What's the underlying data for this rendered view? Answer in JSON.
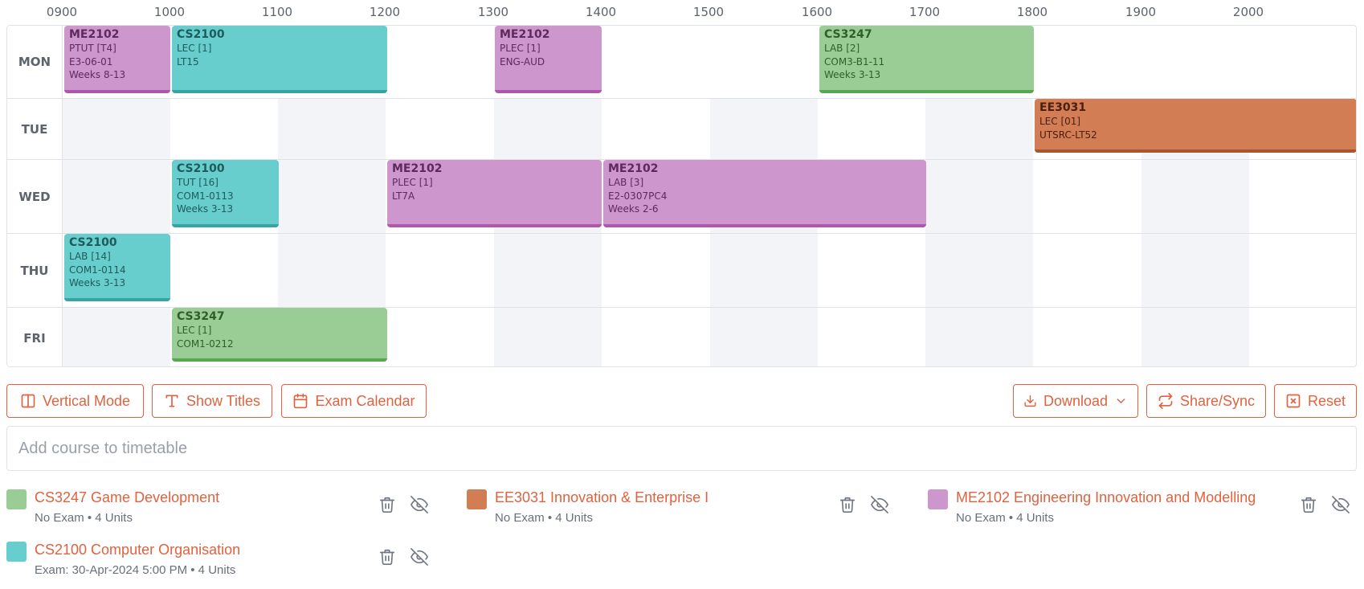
{
  "hours": [
    "0900",
    "1000",
    "1100",
    "1200",
    "1300",
    "1400",
    "1500",
    "1600",
    "1700",
    "1800",
    "1900",
    "2000"
  ],
  "days": [
    "MON",
    "TUE",
    "WED",
    "THU",
    "FRI"
  ],
  "colors": {
    "accent": "#e0623f",
    "green": "#9acd96",
    "teal": "#67cecd",
    "purple": "#cd97cd",
    "orange": "#d37d54",
    "stripe": "#f3f4f7"
  },
  "lessons": {
    "mon_me2102_ptut": {
      "code": "ME2102",
      "type": "PTUT [T4]",
      "venue": "E3-06-01",
      "weeks": "Weeks 8-13"
    },
    "mon_cs2100_lec": {
      "code": "CS2100",
      "type": "LEC [1]",
      "venue": "LT15"
    },
    "mon_me2102_plec": {
      "code": "ME2102",
      "type": "PLEC [1]",
      "venue": "ENG-AUD"
    },
    "mon_cs3247_lab": {
      "code": "CS3247",
      "type": "LAB [2]",
      "venue": "COM3-B1-11",
      "weeks": "Weeks 3-13"
    },
    "tue_ee3031_lec": {
      "code": "EE3031",
      "type": "LEC [01]",
      "venue": "UTSRC-LT52"
    },
    "wed_cs2100_tut": {
      "code": "CS2100",
      "type": "TUT [16]",
      "venue": "COM1-0113",
      "weeks": "Weeks 3-13"
    },
    "wed_me2102_plec": {
      "code": "ME2102",
      "type": "PLEC [1]",
      "venue": "LT7A"
    },
    "wed_me2102_lab": {
      "code": "ME2102",
      "type": "LAB [3]",
      "venue": "E2-0307PC4",
      "weeks": "Weeks 2-6"
    },
    "thu_cs2100_lab": {
      "code": "CS2100",
      "type": "LAB [14]",
      "venue": "COM1-0114",
      "weeks": "Weeks 3-13"
    },
    "fri_cs3247_lec": {
      "code": "CS3247",
      "type": "LEC [1]",
      "venue": "COM1-0212"
    }
  },
  "toolbar": {
    "vertical_mode": "Vertical Mode",
    "show_titles": "Show Titles",
    "exam_calendar": "Exam Calendar",
    "download": "Download",
    "share_sync": "Share/Sync",
    "reset": "Reset"
  },
  "search": {
    "placeholder": "Add course to timetable"
  },
  "modules": [
    {
      "title": "CS3247 Game Development",
      "meta": "No Exam • 4 Units",
      "color": "#9acd96"
    },
    {
      "title": "EE3031 Innovation & Enterprise I",
      "meta": "No Exam • 4 Units",
      "color": "#d37d54"
    },
    {
      "title": "ME2102 Engineering Innovation and Modelling",
      "meta": "No Exam • 4 Units",
      "color": "#cd97cd"
    },
    {
      "title": "CS2100 Computer Organisation",
      "meta": "Exam: 30-Apr-2024 5:00 PM • 4 Units",
      "color": "#67cecd"
    }
  ]
}
